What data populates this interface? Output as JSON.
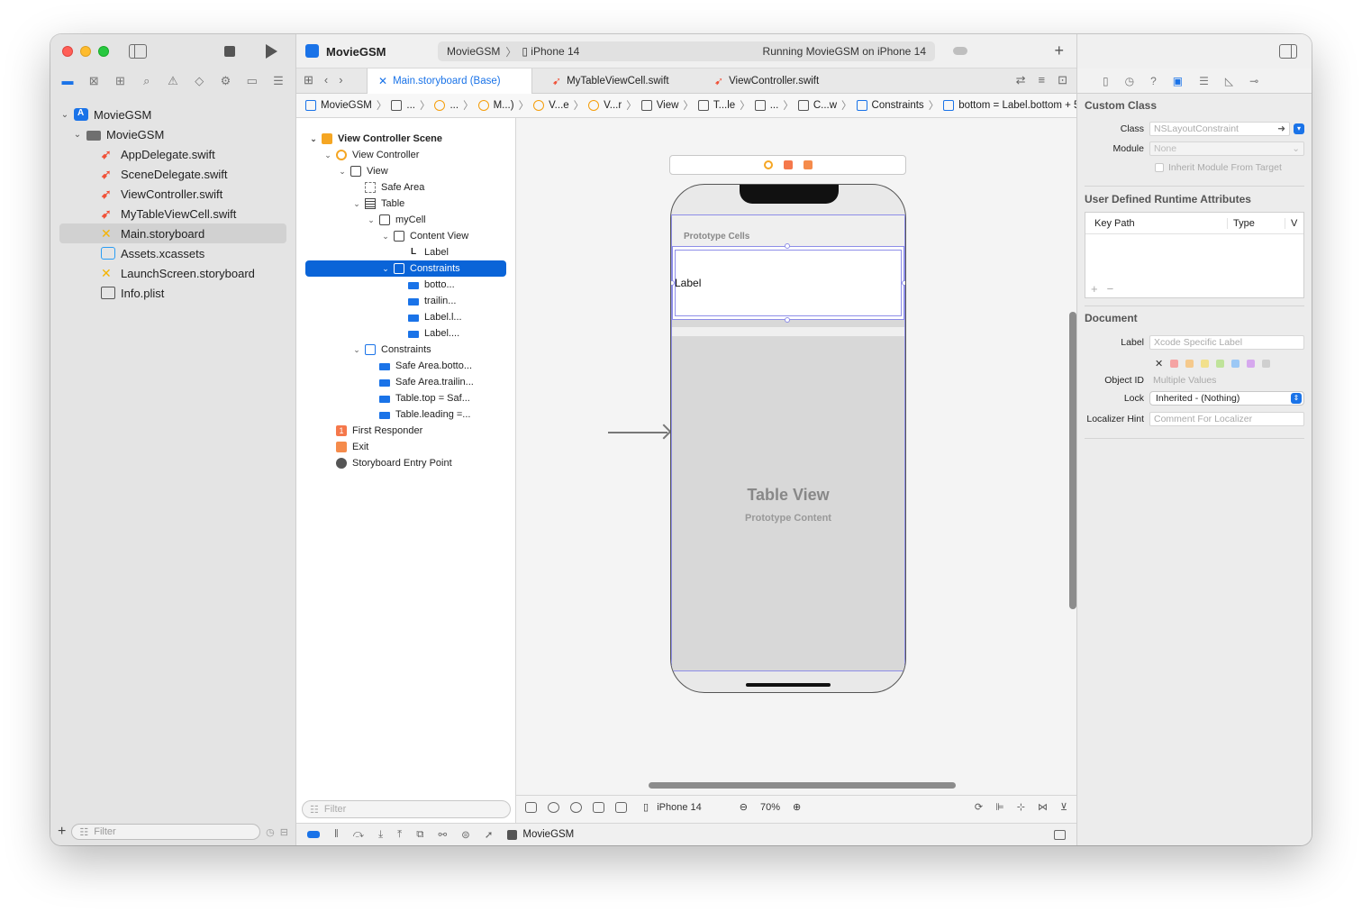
{
  "navigator": {
    "filter_placeholder": "Filter",
    "tree": [
      {
        "label": "MovieGSM",
        "icon": "app-icon",
        "level": 0,
        "expanded": true
      },
      {
        "label": "MovieGSM",
        "icon": "folder-icon",
        "level": 1,
        "expanded": true
      },
      {
        "label": "AppDelegate.swift",
        "icon": "swift-icon",
        "level": 2
      },
      {
        "label": "SceneDelegate.swift",
        "icon": "swift-icon",
        "level": 2
      },
      {
        "label": "ViewController.swift",
        "icon": "swift-icon",
        "level": 2
      },
      {
        "label": "MyTableViewCell.swift",
        "icon": "swift-icon",
        "level": 2
      },
      {
        "label": "Main.storyboard",
        "icon": "storyboard-icon",
        "level": 2,
        "selected": true
      },
      {
        "label": "Assets.xcassets",
        "icon": "assets-icon",
        "level": 2
      },
      {
        "label": "LaunchScreen.storyboard",
        "icon": "storyboard-icon",
        "level": 2
      },
      {
        "label": "Info.plist",
        "icon": "plist-icon",
        "level": 2
      }
    ]
  },
  "toolbar": {
    "project_title": "MovieGSM",
    "scheme": "MovieGSM",
    "device": "iPhone 14",
    "status": "Running MovieGSM on iPhone 14"
  },
  "tabs": [
    {
      "label": "Main.storyboard (Base)",
      "active": true
    },
    {
      "label": "MyTableViewCell.swift",
      "active": false
    },
    {
      "label": "ViewController.swift",
      "active": false
    }
  ],
  "jump_bar": [
    "MovieGSM",
    "...",
    "...",
    "M...)",
    "V...e",
    "V...r",
    "View",
    "T...le",
    "...",
    "C...w",
    "Constraints",
    "bottom = Label.bottom + 5"
  ],
  "outline": {
    "filter_placeholder": "Filter",
    "rows": [
      {
        "label": "View Controller Scene",
        "depth": 0,
        "chev": "v",
        "icon": "scene",
        "bold": true
      },
      {
        "label": "View Controller",
        "depth": 1,
        "chev": "v",
        "icon": "vc"
      },
      {
        "label": "View",
        "depth": 2,
        "chev": "v",
        "icon": "view"
      },
      {
        "label": "Safe Area",
        "depth": 3,
        "chev": "",
        "icon": "safe"
      },
      {
        "label": "Table",
        "depth": 3,
        "chev": "v",
        "icon": "table"
      },
      {
        "label": "myCell",
        "depth": 4,
        "chev": "v",
        "icon": "cell"
      },
      {
        "label": "Content View",
        "depth": 5,
        "chev": "v",
        "icon": "view"
      },
      {
        "label": "Label",
        "depth": 6,
        "chev": "",
        "icon": "label"
      },
      {
        "label": "Constraints",
        "depth": 5,
        "chev": "v",
        "icon": "cons",
        "selected": true
      },
      {
        "label": "botto...",
        "depth": 6,
        "chev": "",
        "icon": "c"
      },
      {
        "label": "trailin...",
        "depth": 6,
        "chev": "",
        "icon": "c"
      },
      {
        "label": "Label.l...",
        "depth": 6,
        "chev": "",
        "icon": "c"
      },
      {
        "label": "Label....",
        "depth": 6,
        "chev": "",
        "icon": "c"
      },
      {
        "label": "Constraints",
        "depth": 3,
        "chev": "v",
        "icon": "cons"
      },
      {
        "label": "Safe Area.botto...",
        "depth": 4,
        "chev": "",
        "icon": "c"
      },
      {
        "label": "Safe Area.trailin...",
        "depth": 4,
        "chev": "",
        "icon": "c"
      },
      {
        "label": "Table.top = Saf...",
        "depth": 4,
        "chev": "",
        "icon": "c"
      },
      {
        "label": "Table.leading =...",
        "depth": 4,
        "chev": "",
        "icon": "c"
      },
      {
        "label": "First Responder",
        "depth": 1,
        "chev": "",
        "icon": "resp"
      },
      {
        "label": "Exit",
        "depth": 1,
        "chev": "",
        "icon": "exit"
      },
      {
        "label": "Storyboard Entry Point",
        "depth": 1,
        "chev": "",
        "icon": "entry"
      }
    ]
  },
  "canvas": {
    "prototype_cells": "Prototype Cells",
    "cell_label": "Label",
    "table_title": "Table View",
    "table_subtitle": "Prototype Content",
    "device": "iPhone 14",
    "zoom": "70%"
  },
  "debug_bar": {
    "project": "MovieGSM"
  },
  "inspector": {
    "custom_class_title": "Custom Class",
    "class_label": "Class",
    "class_placeholder": "NSLayoutConstraint",
    "module_label": "Module",
    "module_value": "None",
    "inherit_label": "Inherit Module From Target",
    "runtime_title": "User Defined Runtime Attributes",
    "col_keypath": "Key Path",
    "col_type": "Type",
    "col_value": "V",
    "document_title": "Document",
    "doc_label": "Label",
    "doc_label_placeholder": "Xcode Specific Label",
    "object_id_label": "Object ID",
    "object_id_value": "Multiple Values",
    "lock_label": "Lock",
    "lock_value": "Inherited - (Nothing)",
    "localizer_label": "Localizer Hint",
    "localizer_placeholder": "Comment For Localizer",
    "swatch_colors": [
      "#f5a3a3",
      "#f5c98c",
      "#f2e08c",
      "#bfe39a",
      "#9cc8f5",
      "#d6a8ee",
      "#cfcfcf"
    ]
  }
}
